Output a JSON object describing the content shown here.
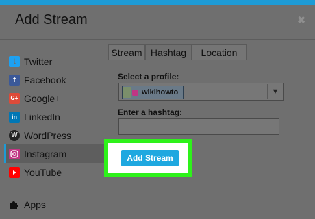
{
  "dialog": {
    "title": "Add Stream",
    "close_glyph": "✖"
  },
  "sidebar": {
    "items": [
      {
        "label": "Twitter",
        "icon": "twitter-icon",
        "color": "#1da1f2",
        "glyph": "🐦"
      },
      {
        "label": "Facebook",
        "icon": "facebook-icon",
        "color": "#3b5998",
        "glyph": "f"
      },
      {
        "label": "Google+",
        "icon": "google-plus-icon",
        "color": "#dd4b39",
        "glyph": "G+"
      },
      {
        "label": "LinkedIn",
        "icon": "linkedin-icon",
        "color": "#0077b5",
        "glyph": "in"
      },
      {
        "label": "WordPress",
        "icon": "wordpress-icon",
        "color": "#21759b",
        "glyph": "W"
      },
      {
        "label": "Instagram",
        "icon": "instagram-icon",
        "color": "#c13584",
        "glyph": "◎"
      },
      {
        "label": "YouTube",
        "icon": "youtube-icon",
        "color": "#ff0000",
        "glyph": "▶"
      },
      {
        "label": "Apps",
        "icon": "apps-puzzle-icon",
        "color": "#333333",
        "glyph": "🧩"
      }
    ],
    "active_index": 5
  },
  "tabs": [
    "Stream",
    "Hashtag",
    "Location"
  ],
  "active_tab": 1,
  "form": {
    "profile_label": "Select a profile:",
    "profile_value": "wikihowto",
    "hashtag_label": "Enter a hashtag:",
    "hashtag_value": "",
    "submit_label": "Add Stream"
  },
  "colors": {
    "accent": "#1e9bd6",
    "button": "#1ea8e0",
    "highlight": "#2ef21a"
  }
}
